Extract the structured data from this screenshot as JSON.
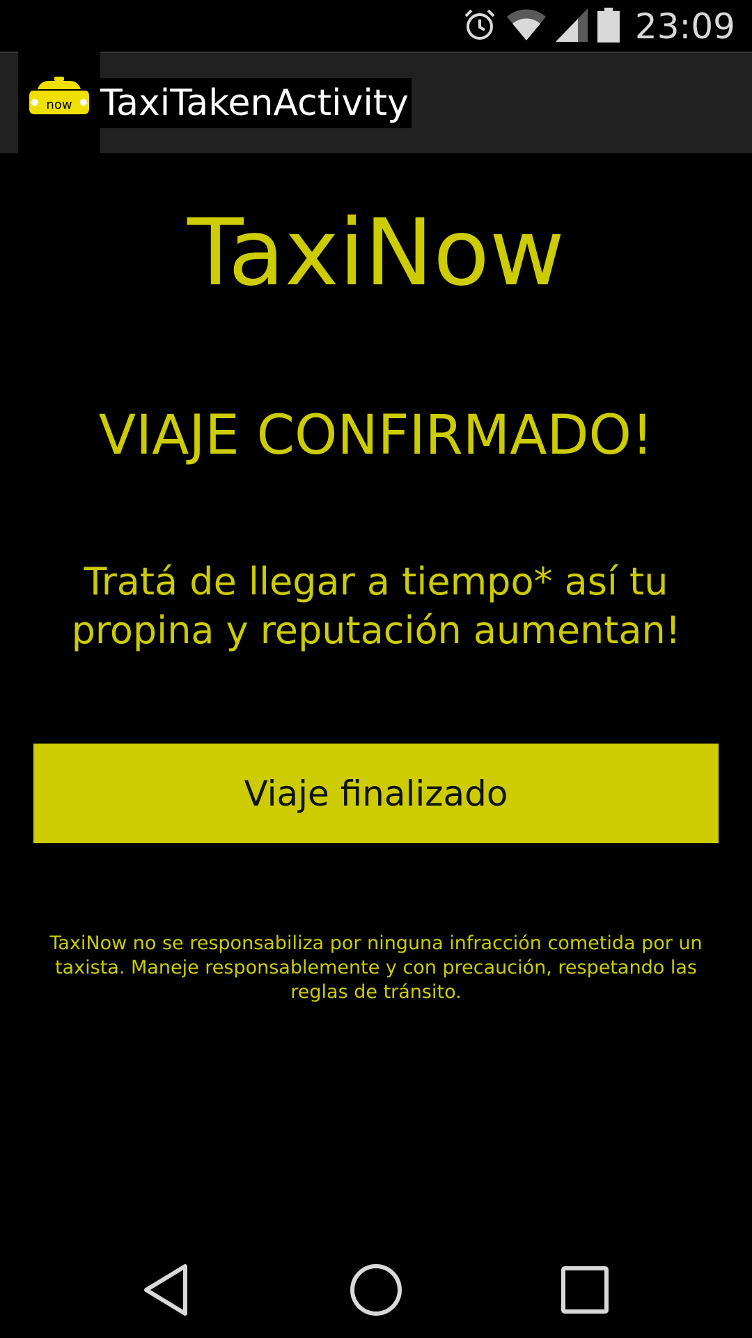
{
  "status_bar": {
    "time": "23:09",
    "icons": [
      "alarm-icon",
      "wifi-icon",
      "cell-signal-icon",
      "battery-icon"
    ]
  },
  "action_bar": {
    "title": "TaxiTakenActivity",
    "app_icon": "taxi-now-app-icon",
    "app_icon_text": "now"
  },
  "main": {
    "brand": "TaxiNow",
    "confirmed": "VIAJE CONFIRMADO!",
    "message": "Tratá de llegar a tiempo* así tu propina y reputación aumentan!",
    "finish_button_label": "Viaje finalizado",
    "disclaimer": "TaxiNow no se responsabiliza por ninguna infracción cometida por un taxista. Maneje responsablemente y con precaución, respetando las reglas de tránsito."
  },
  "nav_bar": {
    "buttons": [
      "back-icon",
      "home-icon",
      "recents-icon"
    ]
  },
  "colors": {
    "accent": "#cccc00",
    "background": "#000000",
    "action_bar": "#212121"
  }
}
